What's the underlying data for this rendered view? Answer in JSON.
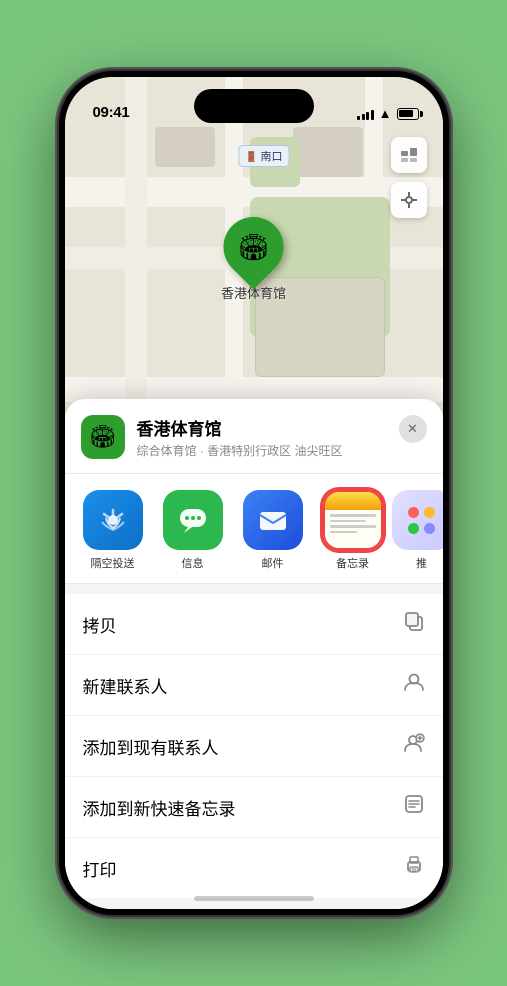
{
  "status_bar": {
    "time": "09:41",
    "navigation_arrow": "▶"
  },
  "map": {
    "exit_label": "南口",
    "stadium_label": "香港体育馆"
  },
  "venue": {
    "name": "香港体育馆",
    "subtitle": "综合体育馆 · 香港特别行政区 油尖旺区",
    "icon": "🏟",
    "close_label": "✕"
  },
  "share_apps": [
    {
      "id": "airdrop",
      "label": "隔空投送"
    },
    {
      "id": "messages",
      "label": "信息"
    },
    {
      "id": "mail",
      "label": "邮件"
    },
    {
      "id": "notes",
      "label": "备忘录"
    },
    {
      "id": "more",
      "label": "推"
    }
  ],
  "actions": [
    {
      "label": "拷贝",
      "icon": "copy"
    },
    {
      "label": "新建联系人",
      "icon": "person"
    },
    {
      "label": "添加到现有联系人",
      "icon": "person-add"
    },
    {
      "label": "添加到新快速备忘录",
      "icon": "memo"
    },
    {
      "label": "打印",
      "icon": "print"
    }
  ],
  "colors": {
    "green_accent": "#2d9e2d",
    "selected_border": "#ef4444",
    "background": "#7bc67e"
  }
}
